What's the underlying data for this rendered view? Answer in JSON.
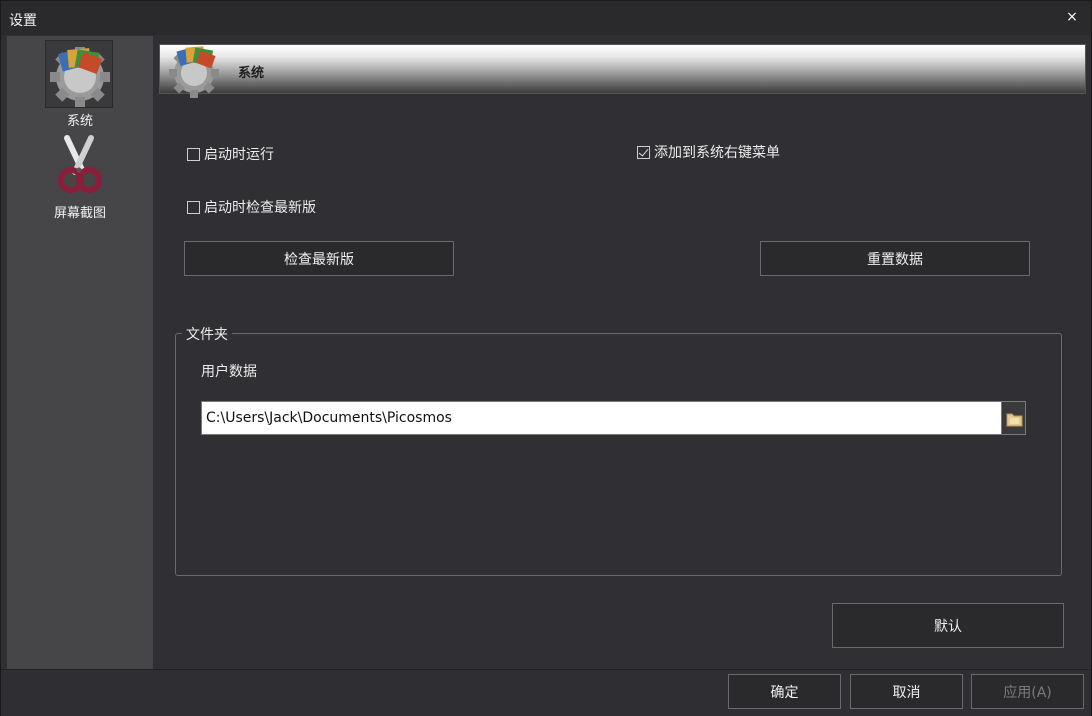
{
  "window": {
    "title": "设置",
    "close_glyph": "×"
  },
  "sidebar": {
    "items": [
      {
        "label": "系统",
        "icon": "system-settings-icon",
        "active": true
      },
      {
        "label": "屏幕截图",
        "icon": "scissors-icon",
        "active": false
      }
    ]
  },
  "section": {
    "title": "系统",
    "icon": "system-settings-icon"
  },
  "options": {
    "run_on_startup": {
      "label": "启动时运行",
      "checked": false
    },
    "check_update_on_startup": {
      "label": "启动时检查最新版",
      "checked": false
    },
    "context_menu": {
      "label": "添加到系统右键菜单",
      "checked": true
    }
  },
  "buttons": {
    "check_update": "检查最新版",
    "reset_data": "重置数据",
    "default": "默认",
    "ok": "确定",
    "cancel": "取消",
    "apply": "应用(A)"
  },
  "folder_group": {
    "title": "文件夹",
    "user_data_label": "用户数据",
    "user_data_path": "C:\\Users\\Jack\\Documents\\Picosmos",
    "browse_icon": "folder-icon"
  },
  "colors": {
    "background": "#2f2f33",
    "sidebar": "#464649",
    "button_border": "#6a6a6e"
  }
}
